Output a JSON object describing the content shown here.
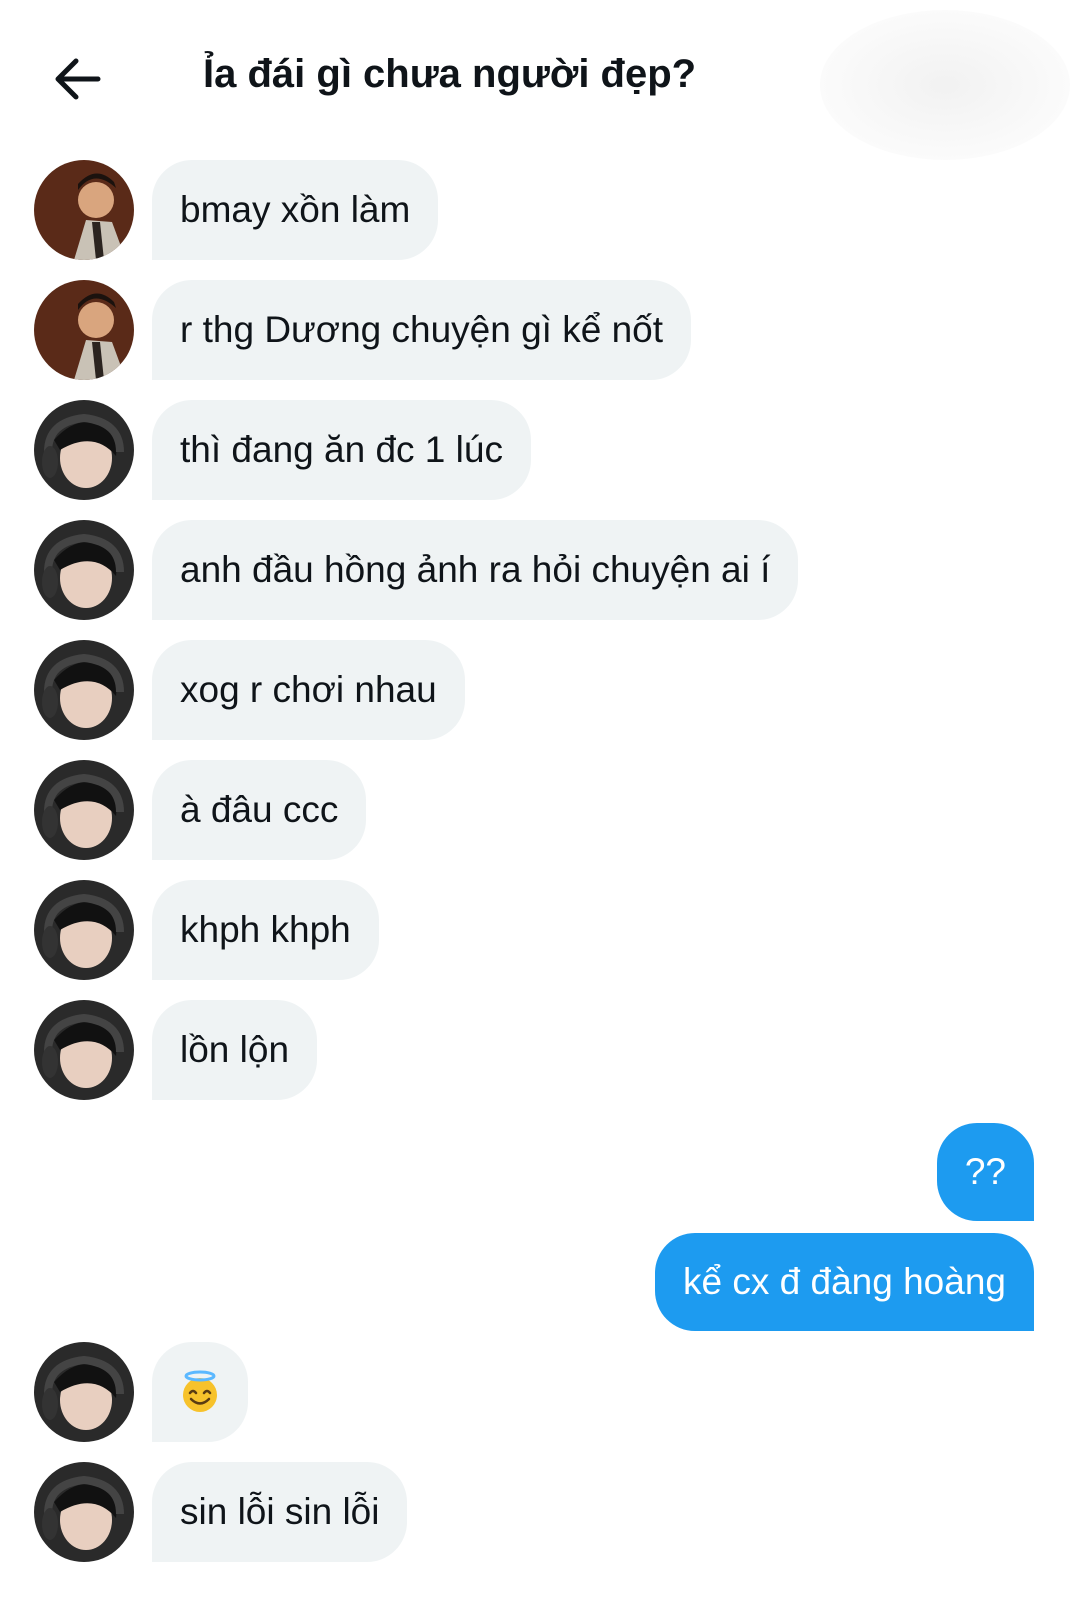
{
  "header": {
    "title": "Ỉa đái gì chưa người đẹp?",
    "back_icon": "arrow-left-icon"
  },
  "colors": {
    "incoming_bubble": "#eff3f4",
    "outgoing_bubble": "#1d9bf0",
    "text": "#0f1419"
  },
  "messages": [
    {
      "sender": "other",
      "avatar": "avatar-user-a",
      "text": "bmay xồn làm"
    },
    {
      "sender": "other",
      "avatar": "avatar-user-a",
      "text": "r thg Dương chuyện gì kể nốt"
    },
    {
      "sender": "other",
      "avatar": "avatar-user-b",
      "text": "thì đang ăn đc 1 lúc"
    },
    {
      "sender": "other",
      "avatar": "avatar-user-b",
      "text": "anh đầu hồng ảnh ra hỏi chuyện ai í"
    },
    {
      "sender": "other",
      "avatar": "avatar-user-b",
      "text": "xog r chơi nhau"
    },
    {
      "sender": "other",
      "avatar": "avatar-user-b",
      "text": "à đâu ccc"
    },
    {
      "sender": "other",
      "avatar": "avatar-user-b",
      "text": "khph khph"
    },
    {
      "sender": "other",
      "avatar": "avatar-user-b",
      "text": "lồn lộn"
    },
    {
      "sender": "me",
      "text": "??"
    },
    {
      "sender": "me",
      "text": "kể cx đ đàng hoàng"
    },
    {
      "sender": "other",
      "avatar": "avatar-user-b",
      "emoji": "smiling-face-with-halo",
      "text": "😇"
    },
    {
      "sender": "other",
      "avatar": "avatar-user-b",
      "text": "sin lỗi sin lỗi"
    }
  ]
}
